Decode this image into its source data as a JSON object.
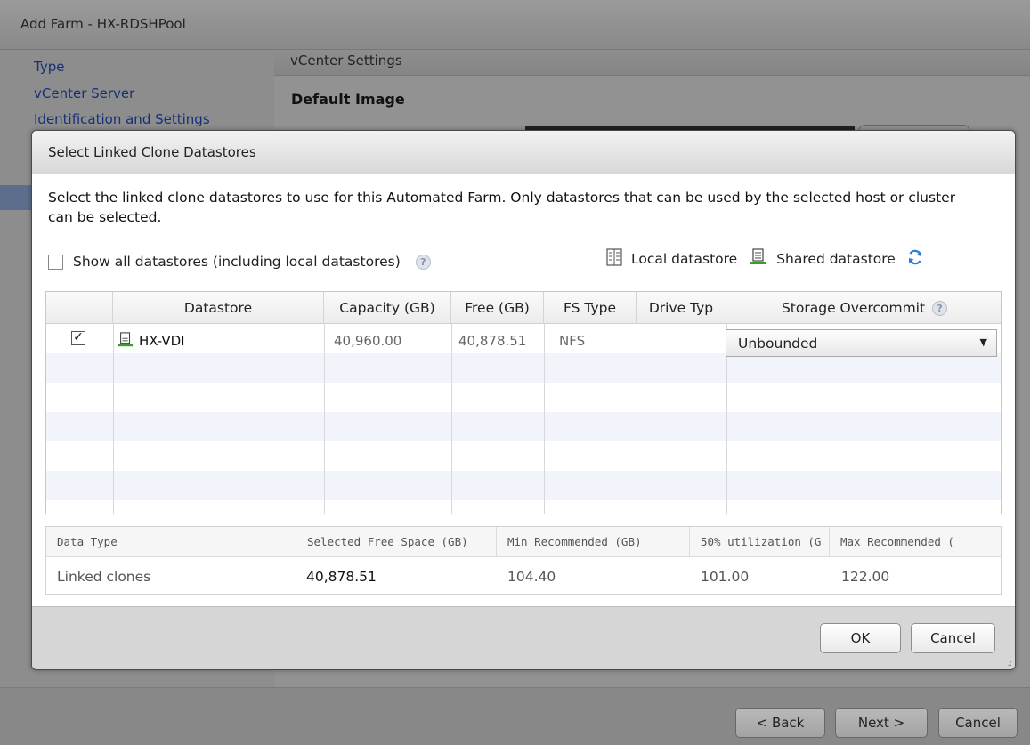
{
  "window": {
    "title": "Add Farm - HX-RDSHPool"
  },
  "wizard_nav": {
    "items": [
      {
        "label": "Type"
      },
      {
        "label": "vCenter Server"
      },
      {
        "label": "Identification and Settings"
      }
    ]
  },
  "background_panel": {
    "section_title": "vCenter Settings",
    "default_image_label": "Default Image"
  },
  "wizard_footer": {
    "back_label": "< Back",
    "next_label": "Next >",
    "cancel_label": "Cancel"
  },
  "dialog": {
    "title": "Select Linked Clone Datastores",
    "description": "Select the linked clone datastores to use for this Automated Farm. Only datastores that can be used by the selected host or cluster can be selected.",
    "show_all_label": "Show all datastores (including local datastores)",
    "show_all_checked": false,
    "legend_local": "Local datastore",
    "legend_shared": "Shared datastore",
    "datastore_table": {
      "headers": [
        "Datastore",
        "Capacity (GB)",
        "Free (GB)",
        "FS Type",
        "Drive Typ",
        "Storage Overcommit"
      ],
      "rows": [
        {
          "checked": true,
          "datastore": "HX-VDI",
          "capacity": "40,960.00",
          "free": "40,878.51",
          "fs_type": "NFS",
          "drive_type": "",
          "overcommit": "Unbounded"
        }
      ]
    },
    "summary_table": {
      "headers": [
        "Data Type",
        "Selected Free Space (GB)",
        "Min Recommended (GB)",
        "50% utilization (G",
        "Max Recommended ("
      ],
      "rows": [
        {
          "data_type": "Linked clones",
          "selected_free": "40,878.51",
          "min_recommended": "104.40",
          "utilization_50": "101.00",
          "max_recommended": "122.00"
        }
      ]
    },
    "ok_label": "OK",
    "cancel_label": "Cancel"
  },
  "colors": {
    "nav_link": "#15307a",
    "refresh_icon": "#2a7bd4",
    "shared_icon": "#3d9a2f"
  }
}
